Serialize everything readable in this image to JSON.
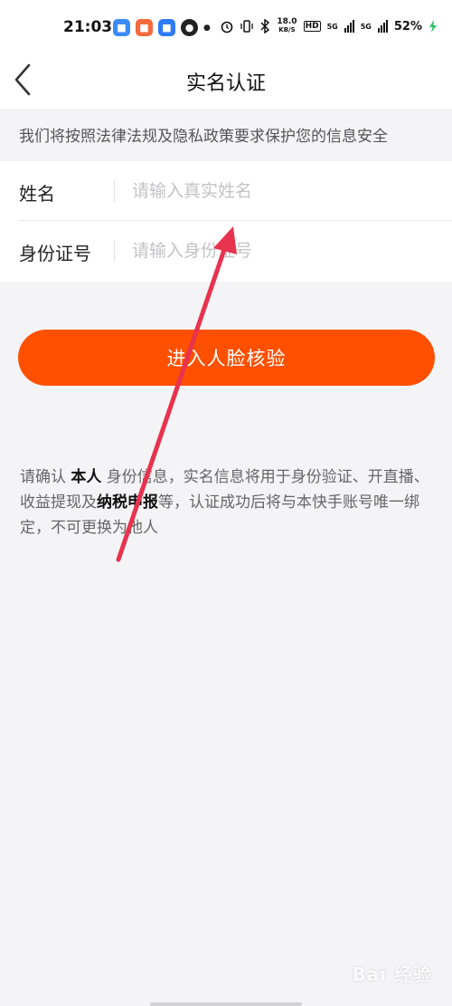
{
  "status_bar": {
    "time": "21:03",
    "net_speed_value": "18.0",
    "net_speed_unit": "KB/S",
    "hd_label": "HD",
    "net1_label": "5G",
    "net2_label": "5G",
    "battery": "52%"
  },
  "header": {
    "title": "实名认证",
    "back_icon": "chevron-left-icon"
  },
  "notice": {
    "text": "我们将按照法律法规及隐私政策要求保护您的信息安全"
  },
  "form": {
    "name_label": "姓名",
    "name_placeholder": "请输入真实姓名",
    "name_value": "",
    "id_label": "身份证号",
    "id_placeholder": "请输入身份证号",
    "id_value": ""
  },
  "cta": {
    "label": "进入人脸核验"
  },
  "disclaimer": {
    "part1": "请确认 ",
    "bold1": "本人",
    "part2": " 身份信息，实名信息将用于身份验证、开直播、收益提现及",
    "bold2": "纳税申报",
    "part3": "等，认证成功后将与本快手账号唯一绑定，不可更换为他人"
  },
  "watermark": {
    "text": "Bai 经验"
  },
  "colors": {
    "accent": "#ff5000",
    "annotation_arrow": "#e8334f"
  }
}
